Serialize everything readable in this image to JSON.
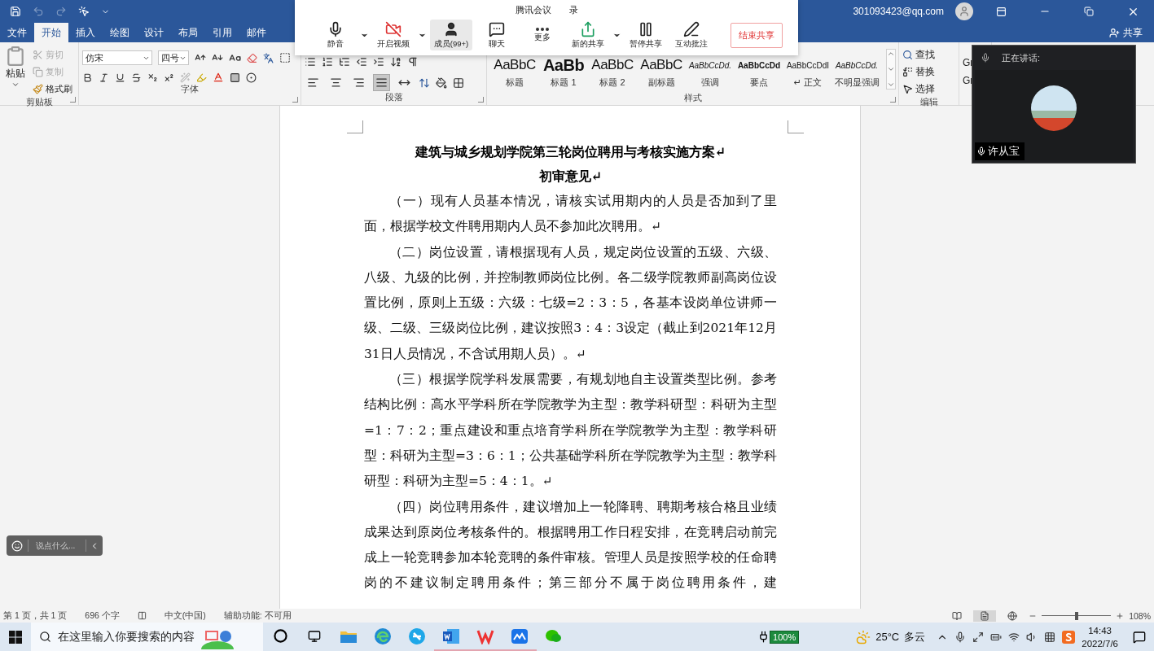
{
  "title_bar": {
    "quick_access": [
      {
        "kind": "save",
        "disabled": false
      },
      {
        "kind": "undo",
        "disabled": true
      },
      {
        "kind": "redo",
        "disabled": true
      },
      {
        "kind": "touch",
        "disabled": false
      }
    ],
    "account": "301093423@qq.com"
  },
  "tabs": [
    {
      "label": "文件",
      "selected": false
    },
    {
      "label": "开始",
      "selected": true
    },
    {
      "label": "插入",
      "selected": false
    },
    {
      "label": "绘图",
      "selected": false
    },
    {
      "label": "设计",
      "selected": false
    },
    {
      "label": "布局",
      "selected": false
    },
    {
      "label": "引用",
      "selected": false
    },
    {
      "label": "邮件",
      "selected": false
    }
  ],
  "share": "共享",
  "ribbon": {
    "clipboard": {
      "label": "剪贴板",
      "paste": "粘贴",
      "items": [
        {
          "kind": "cut",
          "label": "剪切",
          "disabled": true
        },
        {
          "kind": "copy",
          "label": "复制",
          "disabled": true
        },
        {
          "kind": "format_painter",
          "label": "格式刷",
          "disabled": false
        }
      ]
    },
    "font": {
      "label": "字体",
      "font_name": "仿宋",
      "font_size": "四号"
    },
    "paragraph": {
      "label": "段落",
      "alignments": [
        {
          "kind": "left",
          "selected": false
        },
        {
          "kind": "center",
          "selected": false
        },
        {
          "kind": "right",
          "selected": false
        },
        {
          "kind": "justify",
          "selected": true
        },
        {
          "kind": "distributed",
          "selected": false
        }
      ]
    },
    "styles": {
      "label": "样式",
      "items": [
        {
          "kind": "title",
          "sample": "AaBbC",
          "name": "标题"
        },
        {
          "kind": "heading",
          "sample": "AaBb",
          "name": "标题 1"
        },
        {
          "kind": "title",
          "sample": "AaBbC",
          "name": "标题 2"
        },
        {
          "kind": "title",
          "sample": "AaBbC",
          "name": "副标题"
        },
        {
          "kind": "emphasis",
          "sample": "AaBbCcDd.",
          "name": "强调"
        },
        {
          "kind": "strong",
          "sample": "AaBbCcDd",
          "name": "要点"
        },
        {
          "kind": "normal",
          "sample": "AaBbCcDdI",
          "name": "↵ 正文"
        },
        {
          "kind": "emphasis",
          "sample": "AaBbCcDd.",
          "name": "不明显强调"
        }
      ]
    },
    "editing": {
      "label": "编辑",
      "items": [
        {
          "kind": "find",
          "label": "查找"
        },
        {
          "kind": "replace",
          "label": "替换"
        },
        {
          "kind": "select",
          "label": "选择"
        }
      ]
    },
    "group_6": [
      "Gr",
      "Gr"
    ]
  },
  "meeting": {
    "title": "腾讯会议",
    "record": "录",
    "buttons": [
      {
        "kind": "mic",
        "label": "静音",
        "menu": true,
        "selected": false
      },
      {
        "kind": "video_off",
        "label": "开启视频",
        "menu": true,
        "selected": false
      },
      {
        "kind": "members",
        "label": "成员(99+)",
        "menu": false,
        "selected": true
      },
      {
        "kind": "chat",
        "label": "聊天",
        "menu": false,
        "selected": false
      },
      {
        "kind": "more",
        "label": "更多",
        "menu": false,
        "selected": false
      },
      {
        "kind": "new_share",
        "label": "新的共享",
        "menu": true,
        "selected": false
      },
      {
        "kind": "pause_share",
        "label": "暂停共享",
        "menu": false,
        "selected": false
      },
      {
        "kind": "annotate",
        "label": "互动批注",
        "menu": false,
        "selected": false
      }
    ],
    "end_share": "结束共享"
  },
  "document": {
    "title": "建筑与城乡规划学院第三轮岗位聘用与考核实施方案↵",
    "subtitle": "初审意见↵",
    "paragraphs": [
      "（一）现有人员基本情况，请核实试用期内的人员是否加到了里面，根据学校文件聘用期内人员不参加此次聘用。↵",
      "（二）岗位设置，请根据现有人员，规定岗位设置的五级、六级、八级、九级的比例，并控制教师岗位比例。各二级学院教师副高岗位设置比例，原则上五级：六级：七级=2：3：5，各基本设岗单位讲师一级、二级、三级岗位比例，建议按照3：4：3设定（截止到2021年12月31日人员情况，不含试用期人员）。↵",
      "（三）根据学院学科发展需要，有规划地自主设置类型比例。参考结构比例：高水平学科所在学院教学为主型：教学科研型：科研为主型=1：7：2；重点建设和重点培育学科所在学院教学为主型：教学科研型：科研为主型=3：6：1；公共基础学科所在学院教学为主型：教学科研型：科研为主型=5：4：1。↵",
      "（四）岗位聘用条件，建议增加上一轮降聘、聘期考核合格且业绩成果达到原岗位考核条件的。根据聘用工作日程安排，在竞聘启动前完成上一轮竞聘参加本轮竞聘的条件审核。管理人员是按照学校的任命聘岗的不建议制定聘用条件；第三部分不属于岗位聘用条件，建"
    ]
  },
  "chat_bubble": {
    "placeholder": "说点什么..."
  },
  "speaker_panel": {
    "label": "正在讲话:",
    "name": "许从宝"
  },
  "status_bar": {
    "page": "第 1 页，共 1 页",
    "words": "696 个字",
    "language": "中文(中国)",
    "accessibility": "辅助功能: 不可用",
    "views": [
      {
        "kind": "read",
        "selected": false
      },
      {
        "kind": "print",
        "selected": true
      },
      {
        "kind": "web",
        "selected": false
      }
    ],
    "zoom": {
      "level": 0.5,
      "reading": "108%"
    }
  },
  "taskbar": {
    "search_placeholder": "在这里输入你要搜索的内容",
    "apps": [
      {
        "kind": "explorer",
        "running": false
      },
      {
        "kind": "edge",
        "running": false
      },
      {
        "kind": "browser",
        "running": false
      },
      {
        "kind": "word",
        "running": true
      },
      {
        "kind": "wps",
        "running": true
      },
      {
        "kind": "meeting",
        "running": true
      },
      {
        "kind": "wechat",
        "running": false
      }
    ],
    "battery": "100%",
    "weather": {
      "temperature": "25°C",
      "condition": "多云"
    },
    "time": "14:43",
    "date": "2022/7/6"
  }
}
